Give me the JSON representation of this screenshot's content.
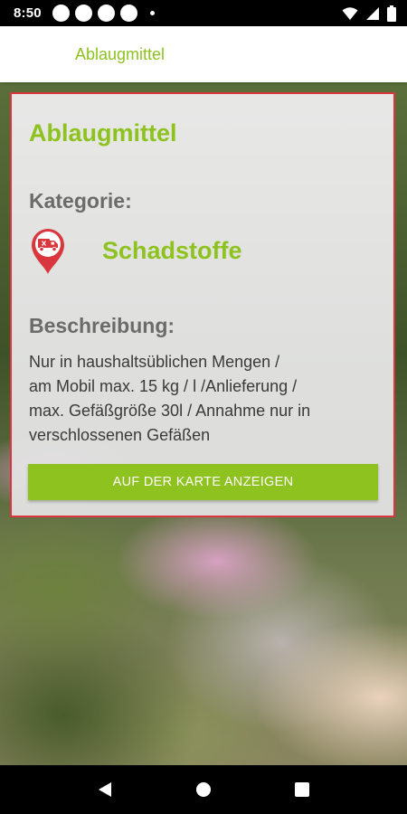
{
  "status_bar": {
    "time": "8:50"
  },
  "app_bar": {
    "title": "Ablaugmittel"
  },
  "card": {
    "title": "Ablaugmittel",
    "category_label": "Kategorie:",
    "category_icon": "hazardous-waste-pin-icon",
    "category_name": "Schadstoffe",
    "description_label": "Beschreibung:",
    "description_lines": [
      "Nur in haushaltsüblichen Mengen /",
      "am Mobil max. 15 kg / l /Anlieferung /",
      "max. Gefäßgröße 30l / Annahme nur in",
      "verschlossenen Gefäßen"
    ],
    "map_button_label": "AUF DER KARTE ANZEIGEN"
  },
  "colors": {
    "accent_green": "#8dc21f",
    "border_red": "#d9363e",
    "label_gray": "#6b6b6b"
  },
  "nav_bar": {
    "back": "back-icon",
    "home": "home-icon",
    "recents": "recents-icon"
  }
}
